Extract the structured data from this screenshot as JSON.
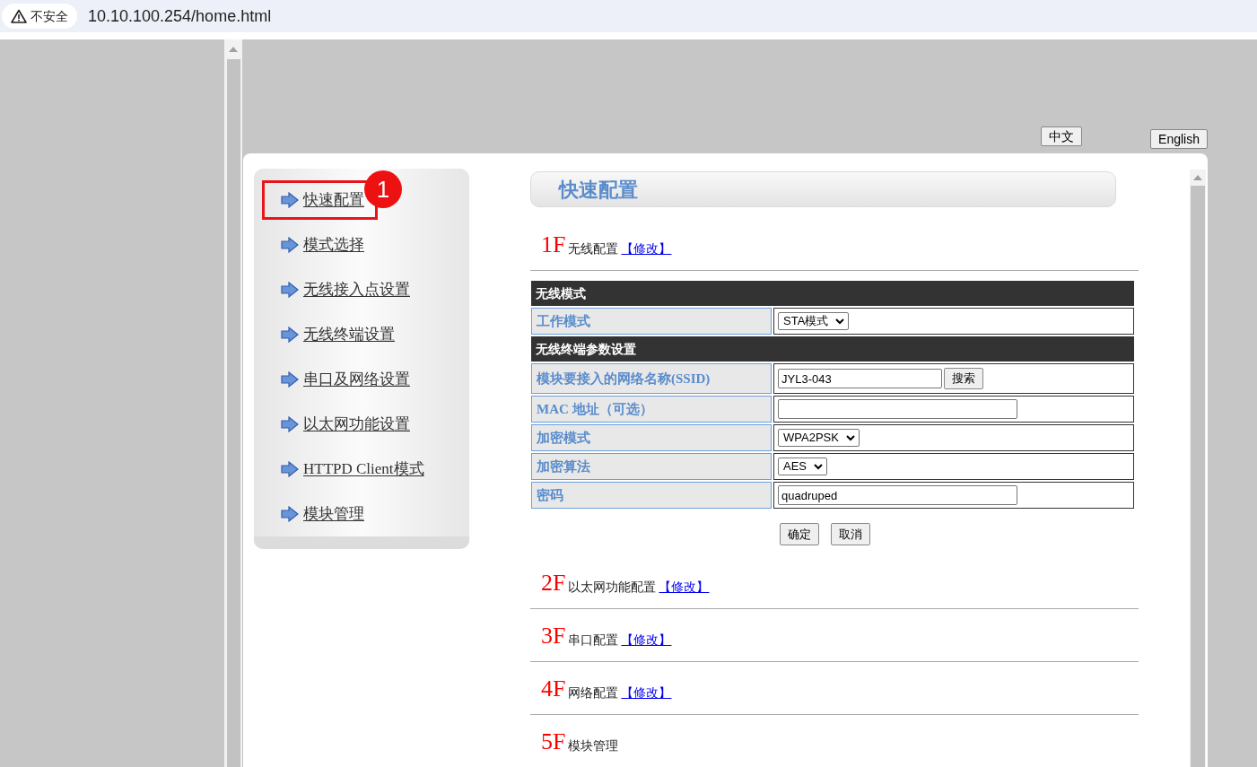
{
  "address_bar": {
    "security_label": "不安全",
    "url": "10.10.100.254/home.html"
  },
  "language_buttons": [
    "中文",
    "English"
  ],
  "sidebar": {
    "items": [
      {
        "label": "快速配置",
        "marked": true,
        "badge": "1"
      },
      {
        "label": "模式选择",
        "marked": false
      },
      {
        "label": "无线接入点设置",
        "marked": false
      },
      {
        "label": "无线终端设置",
        "marked": false
      },
      {
        "label": "串口及网络设置",
        "marked": false
      },
      {
        "label": "以太网功能设置",
        "marked": false
      },
      {
        "label": "HTTPD Client模式",
        "marked": false
      },
      {
        "label": "模块管理",
        "marked": false
      }
    ]
  },
  "page_title": "快速配置",
  "sections": [
    {
      "number": "1F",
      "title": "无线配置",
      "link": "【修改】",
      "form": {
        "groups": [
          {
            "heading": "无线模式",
            "rows": [
              {
                "label": "工作模式",
                "kind": "select",
                "value": "STA模式"
              }
            ]
          },
          {
            "heading": "无线终端参数设置",
            "rows": [
              {
                "label": "模块要接入的网络名称(SSID)",
                "kind": "search",
                "value": "JYL3-043",
                "button": "搜索"
              },
              {
                "label": "MAC 地址（可选）",
                "kind": "text"
              },
              {
                "label": "加密模式",
                "kind": "select",
                "value": "WPA2PSK"
              },
              {
                "label": "加密算法",
                "kind": "select",
                "value": "AES"
              },
              {
                "label": "密码",
                "kind": "text",
                "value": "quadruped"
              }
            ]
          }
        ],
        "buttons": [
          "确定",
          "取消"
        ]
      }
    },
    {
      "number": "2F",
      "title": "以太网功能配置",
      "link": "【修改】"
    },
    {
      "number": "3F",
      "title": "串口配置",
      "link": "【修改】"
    },
    {
      "number": "4F",
      "title": "网络配置",
      "link": "【修改】"
    },
    {
      "number": "5F",
      "title": "模块管理"
    }
  ]
}
